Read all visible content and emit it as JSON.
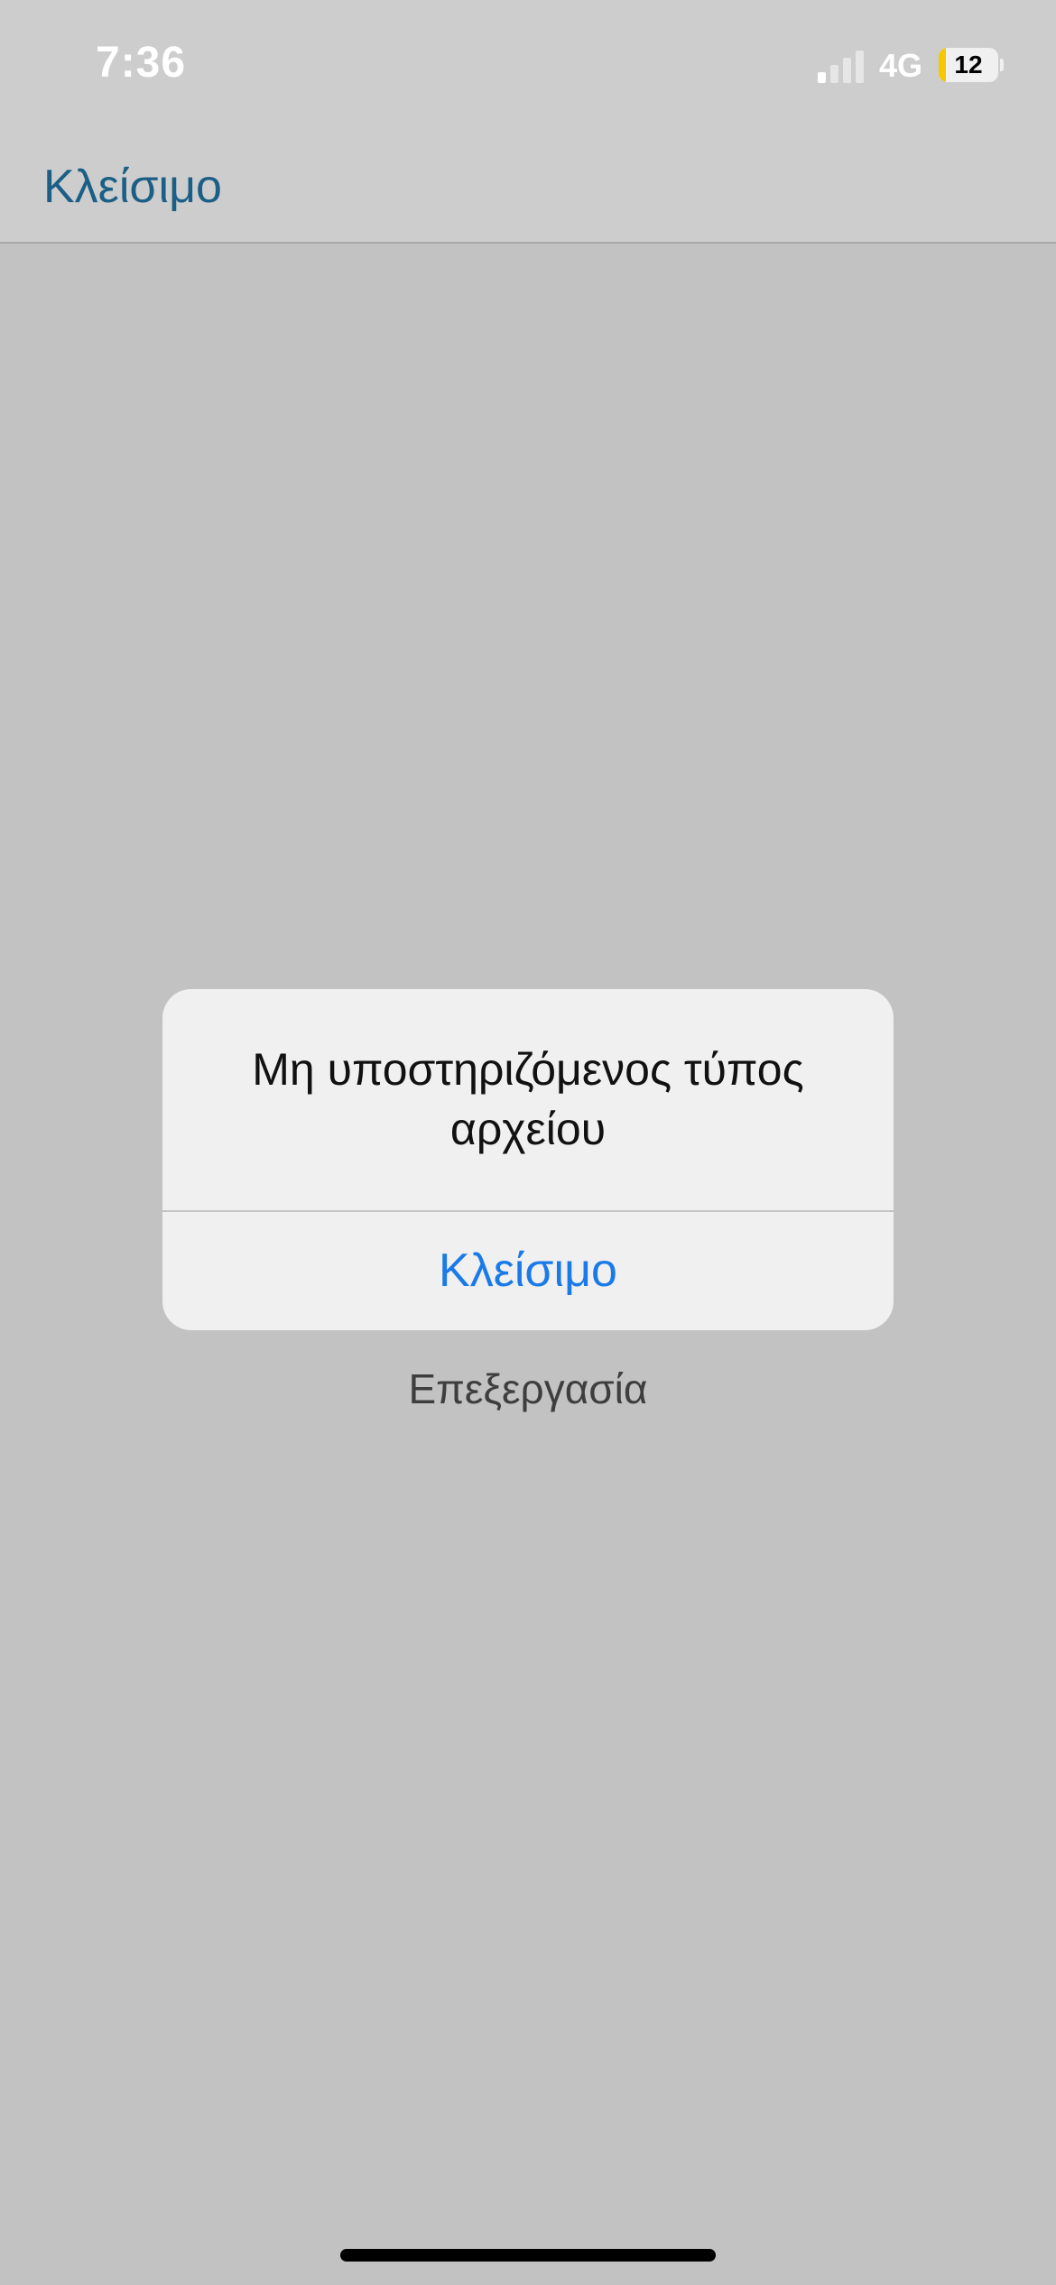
{
  "status_bar": {
    "time": "7:36",
    "network": "4G",
    "battery_level": "12",
    "battery_fraction": 0.12,
    "signal_bars_total": 4,
    "signal_bars_active": 1,
    "battery_color": "#f5c800"
  },
  "nav": {
    "close_label": "Κλείσιμο",
    "accent_color": "#1b5f87"
  },
  "background": {
    "edit_label": "Επεξεργασία"
  },
  "alert": {
    "message": "Μη υποστηριζόμενος τύπος αρχείου",
    "button_label": "Κλείσιμο",
    "button_color": "#1a7ae8"
  }
}
